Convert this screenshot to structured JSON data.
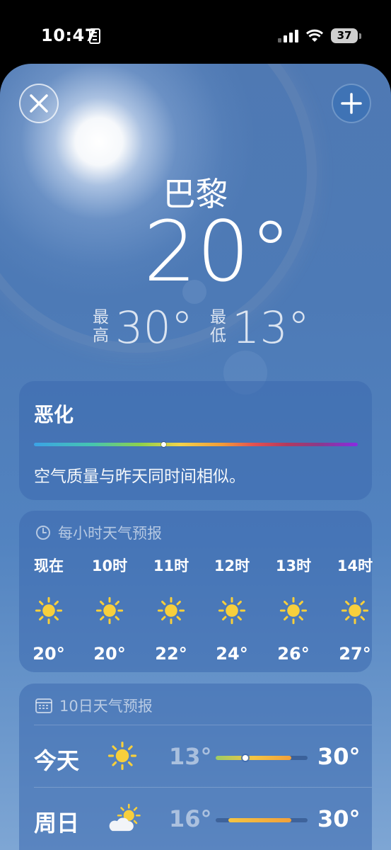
{
  "status_bar": {
    "time": "10:47",
    "battery": "37"
  },
  "header": {
    "city": "巴黎",
    "temperature": "20°",
    "high_label": "最高",
    "high": "30°",
    "low_label": "最低",
    "low": "13°"
  },
  "air_quality": {
    "title": "恶化",
    "description": "空气质量与昨天同时间相似。",
    "level": 0.4
  },
  "hourly": {
    "title": "每小时天气预报",
    "items": [
      {
        "time": "现在",
        "icon": "sun-icon",
        "temp": "20°"
      },
      {
        "time": "10时",
        "icon": "sun-icon",
        "temp": "20°"
      },
      {
        "time": "11时",
        "icon": "sun-icon",
        "temp": "22°"
      },
      {
        "time": "12时",
        "icon": "sun-icon",
        "temp": "24°"
      },
      {
        "time": "13时",
        "icon": "sun-icon",
        "temp": "26°"
      },
      {
        "time": "14时",
        "icon": "sun-icon",
        "temp": "27°"
      }
    ]
  },
  "daily": {
    "title": "10日天气预报",
    "items": [
      {
        "day": "今天",
        "icon": "sun-icon",
        "low": "13°",
        "high": "30°",
        "range_start": 0.0,
        "range_end": 0.82,
        "current": 0.32
      },
      {
        "day": "周日",
        "icon": "partly-cloudy-icon",
        "low": "16°",
        "high": "30°",
        "range_start": 0.14,
        "range_end": 0.82
      }
    ]
  },
  "colors": {
    "accent": "#3f73b5",
    "sun": "#f7cf3c",
    "temp_dim": "rgba(255,255,255,0.5)"
  }
}
